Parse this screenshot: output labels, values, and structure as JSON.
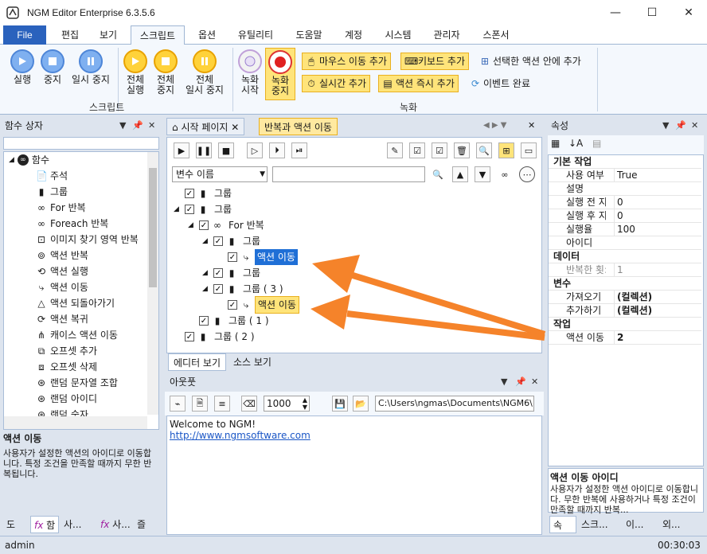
{
  "window": {
    "title": "NGM Editor  Enterprise 6.3.5.6",
    "minimize": "—",
    "maximize": "☐",
    "close": "✕"
  },
  "menu": {
    "file": "File",
    "items": [
      "편집",
      "보기",
      "스크립트",
      "옵션",
      "유틸리티",
      "도움말",
      "계정",
      "시스템",
      "관리자",
      "스폰서"
    ],
    "active": "스크립트"
  },
  "ribbon": {
    "script_group": "스크립트",
    "record_group": "녹화",
    "run": "실행",
    "stop": "중지",
    "pause": "일시 중지",
    "run_all": [
      "전체",
      "실행"
    ],
    "stop_all": [
      "전체",
      "중지"
    ],
    "pause_all": [
      "전체",
      "일시 중지"
    ],
    "record_start": [
      "녹화",
      "시작"
    ],
    "record_stop": [
      "녹화",
      "중지"
    ],
    "mouse_move": "마우스 이동 추가",
    "keyboard": "키보드 추가",
    "in_selected": "선택한 액션 안에 추가",
    "realtime": "실시간 추가",
    "action_now": "액션 즉시 추가",
    "event_done": "이벤트 완료"
  },
  "left_panel": {
    "title": "함수 상자",
    "root": "함수",
    "items": [
      "주석",
      "그룹",
      "For 반복",
      "Foreach 반복",
      "이미지 찾기 영역 반복",
      "액션 반복",
      "액션 실행",
      "액션 이동",
      "액션 되돌아가기",
      "액션 복귀",
      "캐이스 액션 이동",
      "오프셋 추가",
      "오프셋 삭제",
      "랜덤 문자열 조합",
      "랜덤 아이디",
      "랜덤 숫자"
    ],
    "desc_title": "액션 이동",
    "desc_text": "사용자가 설정한 액션의 아이디로 이동합니다. 특정 조건을 만족할 때까지 무한 반복됩니다.",
    "bottom_tabs": [
      "도",
      "함",
      "사...",
      "사...",
      "즐"
    ]
  },
  "editor": {
    "tabs": [
      "시작 페이지",
      "반복과 액션 이동"
    ],
    "active_tab": "반복과 액션 이동",
    "search_select": "변수 이름",
    "search_value": "",
    "tree": [
      {
        "label": "그룹",
        "depth": 0,
        "type": "group",
        "expander": ""
      },
      {
        "label": "그룹",
        "depth": 0,
        "type": "group",
        "expander": "◢"
      },
      {
        "label": "For 반복",
        "depth": 1,
        "type": "loop",
        "expander": "◢"
      },
      {
        "label": "그룹",
        "depth": 2,
        "type": "group",
        "expander": "◢"
      },
      {
        "label": "액션 이동",
        "depth": 3,
        "type": "move",
        "expander": "",
        "state": "selected"
      },
      {
        "label": "그룹",
        "depth": 2,
        "type": "group",
        "expander": "◢"
      },
      {
        "label": "그룹 ( 3 )",
        "depth": 2,
        "type": "group",
        "expander": "◢"
      },
      {
        "label": "액션 이동",
        "depth": 3,
        "type": "move",
        "expander": "",
        "state": "highlight"
      },
      {
        "label": "그룹 ( 1 )",
        "depth": 1,
        "type": "group",
        "expander": ""
      },
      {
        "label": "그룹 ( 2 )",
        "depth": 0,
        "type": "group",
        "expander": ""
      }
    ],
    "bottom_tabs": [
      "에디터 보기",
      "소스 보기"
    ]
  },
  "output": {
    "title": "아웃풋",
    "count": "1000",
    "path": "C:\\Users\\ngmas\\Documents\\NGM6\\",
    "welcome": "Welcome to NGM!",
    "link": "http://www.ngmsoftware.com"
  },
  "properties": {
    "title": "속성",
    "groups": [
      {
        "name": "기본 작업",
        "rows": [
          [
            "사용 여부",
            "True"
          ],
          [
            "설명",
            ""
          ],
          [
            "실행 전 지",
            "0"
          ],
          [
            "실행 후 지",
            "0"
          ],
          [
            "실행율",
            "100"
          ],
          [
            "아이디",
            ""
          ]
        ]
      },
      {
        "name": "데이터",
        "rows": [
          [
            "반복한 횟:",
            "1"
          ]
        ]
      },
      {
        "name": "변수",
        "rows": [
          [
            "가져오기",
            "(컬렉션)"
          ],
          [
            "추가하기",
            "(컬렉션)"
          ]
        ]
      },
      {
        "name": "작업",
        "rows": [
          [
            "액션 이동",
            "2"
          ]
        ]
      }
    ],
    "desc_title": "액션 이동 아이디",
    "desc_text": "사용자가 설정한 액션 아이디로 이동합니다. 무한 반복에 사용하거나 특정 조건이 만족할 때까지 반복...",
    "bottom_tabs": [
      "속",
      "스크...",
      "이...",
      "외..."
    ]
  },
  "status": {
    "user": "admin",
    "time": "00:30:03"
  },
  "colors": {
    "accent": "#2a62bd",
    "arrow": "#f5832a",
    "selected": "#1f6fd6",
    "highlight": "#ffe47a"
  }
}
